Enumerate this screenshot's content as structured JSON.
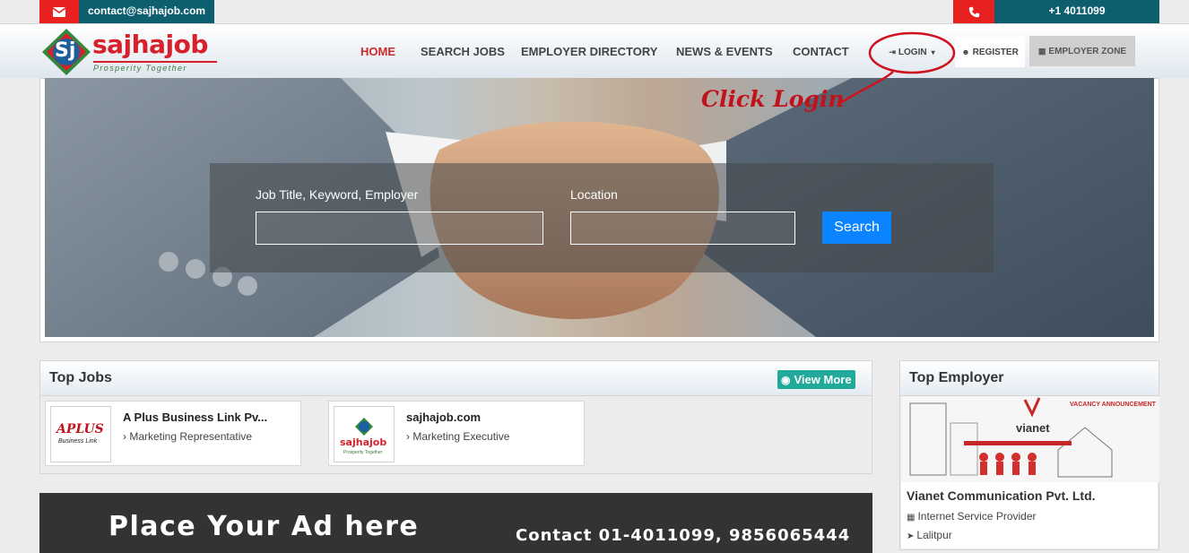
{
  "topbar": {
    "email": "contact@sajhajob.com",
    "phone": "+1 4011099",
    "mail_icon": "envelope-icon",
    "phone_icon": "phone-icon"
  },
  "logo": {
    "mark": "Sj",
    "name": "sajhajob",
    "tagline": "Prosperity Together"
  },
  "nav": {
    "items": [
      {
        "label": "HOME",
        "active": true
      },
      {
        "label": "SEARCH JOBS"
      },
      {
        "label": "EMPLOYER DIRECTORY"
      },
      {
        "label": "NEWS & EVENTS"
      },
      {
        "label": "CONTACT"
      }
    ],
    "login": "LOGIN",
    "register": "REGISTER",
    "employer_zone": "EMPLOYER ZONE",
    "login_icon": "sign-in-icon",
    "register_icon": "user-add-icon",
    "employer_icon": "building-icon"
  },
  "hero": {
    "annotation": "Click Login",
    "keyword_label": "Job Title, Keyword, Employer",
    "keyword_value": "",
    "location_label": "Location",
    "location_value": "",
    "search_button": "Search"
  },
  "top_jobs": {
    "title": "Top Jobs",
    "view_more": "View More",
    "view_icon": "eye-icon",
    "jobs": [
      {
        "company": "A Plus Business Link Pv...",
        "position": "› Marketing Representative",
        "logo_text": "APLUS",
        "logo_sub": "Business Link"
      },
      {
        "company": "sajhajob.com",
        "position": "› Marketing Executive",
        "logo_text": "sajhajob",
        "logo_sub": "Prosperity Together"
      }
    ]
  },
  "ad": {
    "main": "Place Your Ad here",
    "contact": "Contact 01-4011099, 9856065444"
  },
  "top_employer": {
    "title": "Top Employer",
    "banner_brand": "vianet",
    "banner_text": "VACANCY ANNOUNCEMENT",
    "company": "Vianet Communication Pvt. Ltd.",
    "industry": "Internet Service Provider",
    "location": "Lalitpur",
    "industry_icon": "building-icon",
    "location_icon": "location-arrow-icon"
  },
  "colors": {
    "brand_red": "#d7202b",
    "teal": "#0d5f70",
    "search_blue": "#0a84ff",
    "view_more_green": "#21a99a"
  }
}
